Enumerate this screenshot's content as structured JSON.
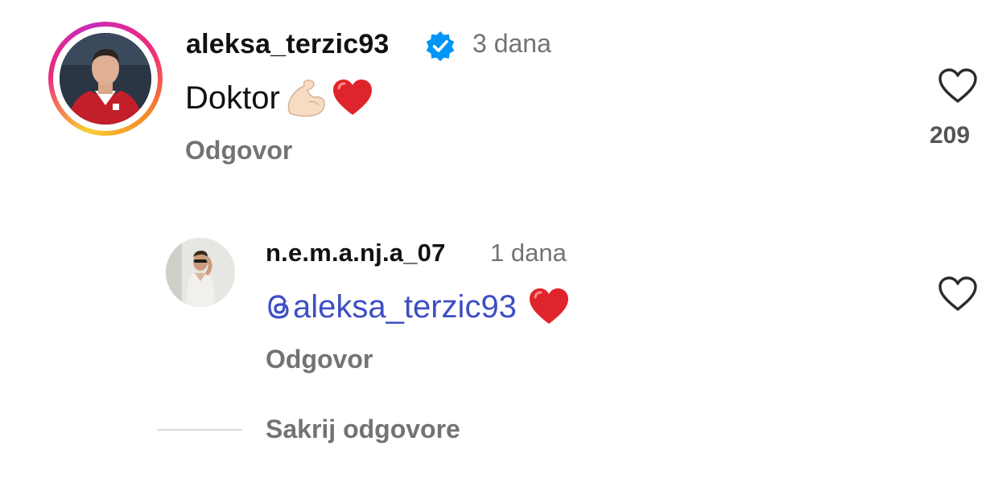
{
  "comments": [
    {
      "username": "aleksa_terzic93",
      "verified": true,
      "time": "3 dana",
      "text": "Doktor",
      "emojis": [
        "flexed-biceps",
        "red-heart"
      ],
      "reply_label": "Odgovor",
      "likes": "209",
      "avatar_ring": true
    },
    {
      "username": "n.e.m.a.nj.a_07",
      "time": "1 dana",
      "mention": "aleksa_terzic93",
      "emojis": [
        "red-heart"
      ],
      "reply_label": "Odgovor"
    }
  ],
  "hide_replies_label": "Sakrij odgovore",
  "colors": {
    "mention": "#3e4fc3",
    "verified": "#0095f6",
    "heart_emoji": "#e0242b",
    "secondary_text": "#737373"
  }
}
